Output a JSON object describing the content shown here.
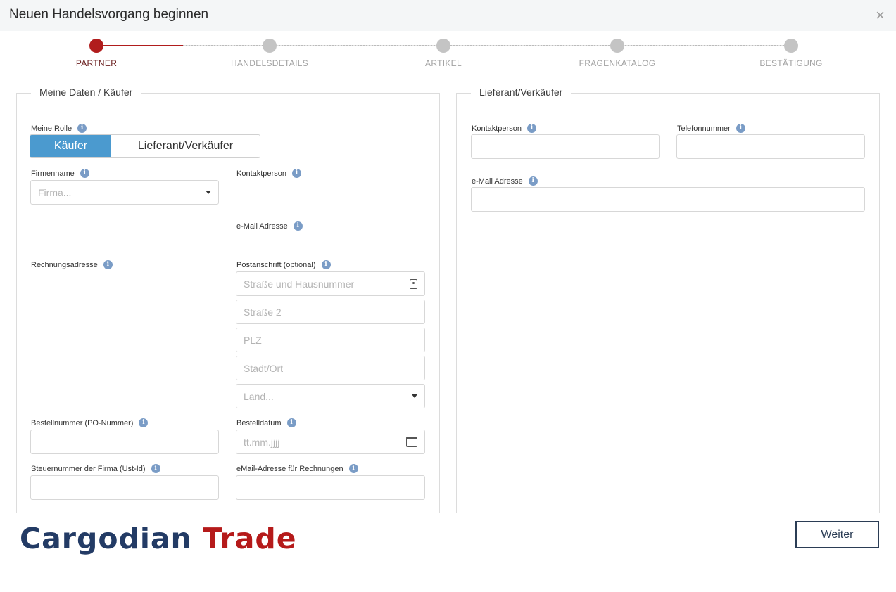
{
  "dialog": {
    "title": "Neuen Handelsvorgang beginnen",
    "close_glyph": "×"
  },
  "stepper": {
    "steps": [
      "PARTNER",
      "HANDELSDETAILS",
      "ARTIKEL",
      "FRAGENKATALOG",
      "BESTÄTIGUNG"
    ],
    "current_step": 1,
    "current_progress": 0.5,
    "accent_color": "#b11d1d"
  },
  "buyer": {
    "legend": "Meine Daten / Käufer",
    "role_label": "Meine Rolle",
    "role_options": [
      "Käufer",
      "Lieferant/Verkäufer"
    ],
    "role_selected": "Käufer",
    "company_label": "Firmenname",
    "company_placeholder": "Firma...",
    "contact_label": "Kontaktperson",
    "email_label": "e-Mail Adresse",
    "billing_label": "Rechnungsadresse",
    "postal_label": "Postanschrift (optional)",
    "street_placeholder": "Straße und Hausnummer",
    "street2_placeholder": "Straße 2",
    "zip_placeholder": "PLZ",
    "city_placeholder": "Stadt/Ort",
    "country_placeholder": "Land...",
    "po_label": "Bestellnummer (PO-Nummer)",
    "order_date_label": "Bestelldatum",
    "order_date_placeholder": "tt.mm.jjjj",
    "tax_label": "Steuernummer der Firma (Ust-Id)",
    "invoice_email_label": "eMail-Adresse für Rechnungen"
  },
  "seller": {
    "legend": "Lieferant/Verkäufer",
    "contact_label": "Kontaktperson",
    "phone_label": "Telefonnummer",
    "email_label": "e-Mail Adresse"
  },
  "logo": {
    "part1": "Cargodian",
    "part2": "Trade"
  },
  "footer": {
    "next_label": "Weiter"
  },
  "colors": {
    "primary": "#4b9acf",
    "logo_blue": "#233b65",
    "logo_red": "#b51a1a"
  }
}
